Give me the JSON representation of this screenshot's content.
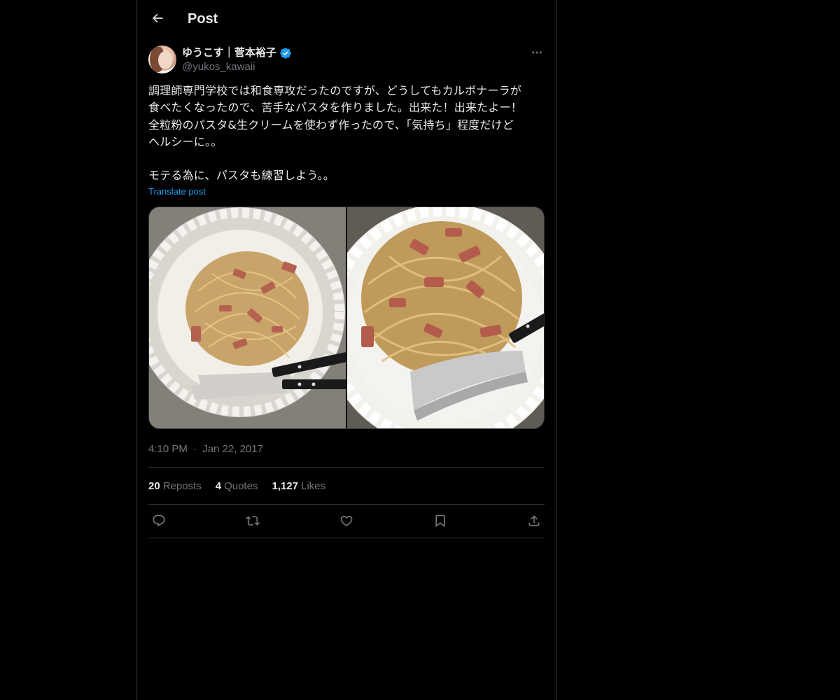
{
  "header": {
    "title": "Post"
  },
  "post": {
    "author": {
      "display_name": "ゆうこす｜菅本裕子",
      "handle": "@yukos_kawaii",
      "verified": true
    },
    "text": "調理師専門学校では和食専攻だったのですが、どうしてもカルボナーラが\n食べたくなったので、苦手なパスタを作りました。出来た！出来たよー！\n全粒粉のパスタ&生クリームを使わず作ったので、「気持ち」程度だけど\nヘルシーに。。\n\nモテる為に、パスタも練習しよう。。",
    "translate_label": "Translate post",
    "media": [
      {
        "description": "carbonara-plate-photo-1"
      },
      {
        "description": "carbonara-plate-photo-2"
      }
    ],
    "time": "4:10 PM",
    "separator": "·",
    "date": "Jan 22, 2017",
    "stats": {
      "reposts_count": "20",
      "reposts_label": "Reposts",
      "quotes_count": "4",
      "quotes_label": "Quotes",
      "likes_count": "1,127",
      "likes_label": "Likes"
    }
  },
  "colors": {
    "background": "#000000",
    "text_primary": "#e7e9ea",
    "text_secondary": "#71767b",
    "accent": "#1d9bf0",
    "border": "#2f3336"
  },
  "icons": {
    "back": "arrow-left-icon",
    "more": "more-horizontal-icon",
    "verified": "verified-badge-icon",
    "reply": "reply-icon",
    "repost": "repost-icon",
    "like": "heart-icon",
    "bookmark": "bookmark-icon",
    "share": "share-icon"
  }
}
